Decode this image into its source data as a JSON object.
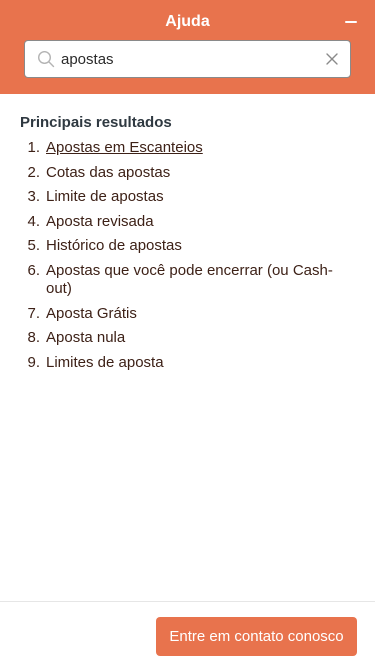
{
  "header": {
    "title": "Ajuda",
    "minimize_icon": "minimize-icon",
    "background_color": "#e8734d"
  },
  "search": {
    "value": "apostas",
    "placeholder": "",
    "search_icon": "search-icon",
    "clear_icon": "close-icon"
  },
  "results": {
    "heading": "Principais resultados",
    "items": [
      {
        "number": "1.",
        "label": "Apostas em Escanteios"
      },
      {
        "number": "2.",
        "label": "Cotas das apostas"
      },
      {
        "number": "3.",
        "label": "Limite de apostas"
      },
      {
        "number": "4.",
        "label": "Aposta revisada"
      },
      {
        "number": "5.",
        "label": "Histórico de apostas"
      },
      {
        "number": "6.",
        "label": "Apostas que você pode encerrar (ou Cash-out)"
      },
      {
        "number": "7.",
        "label": "Aposta Grátis"
      },
      {
        "number": "8.",
        "label": "Aposta nula"
      },
      {
        "number": "9.",
        "label": "Limites de aposta"
      }
    ]
  },
  "footer": {
    "contact_label": "Entre em contato conosco",
    "button_color": "#e8734d"
  }
}
